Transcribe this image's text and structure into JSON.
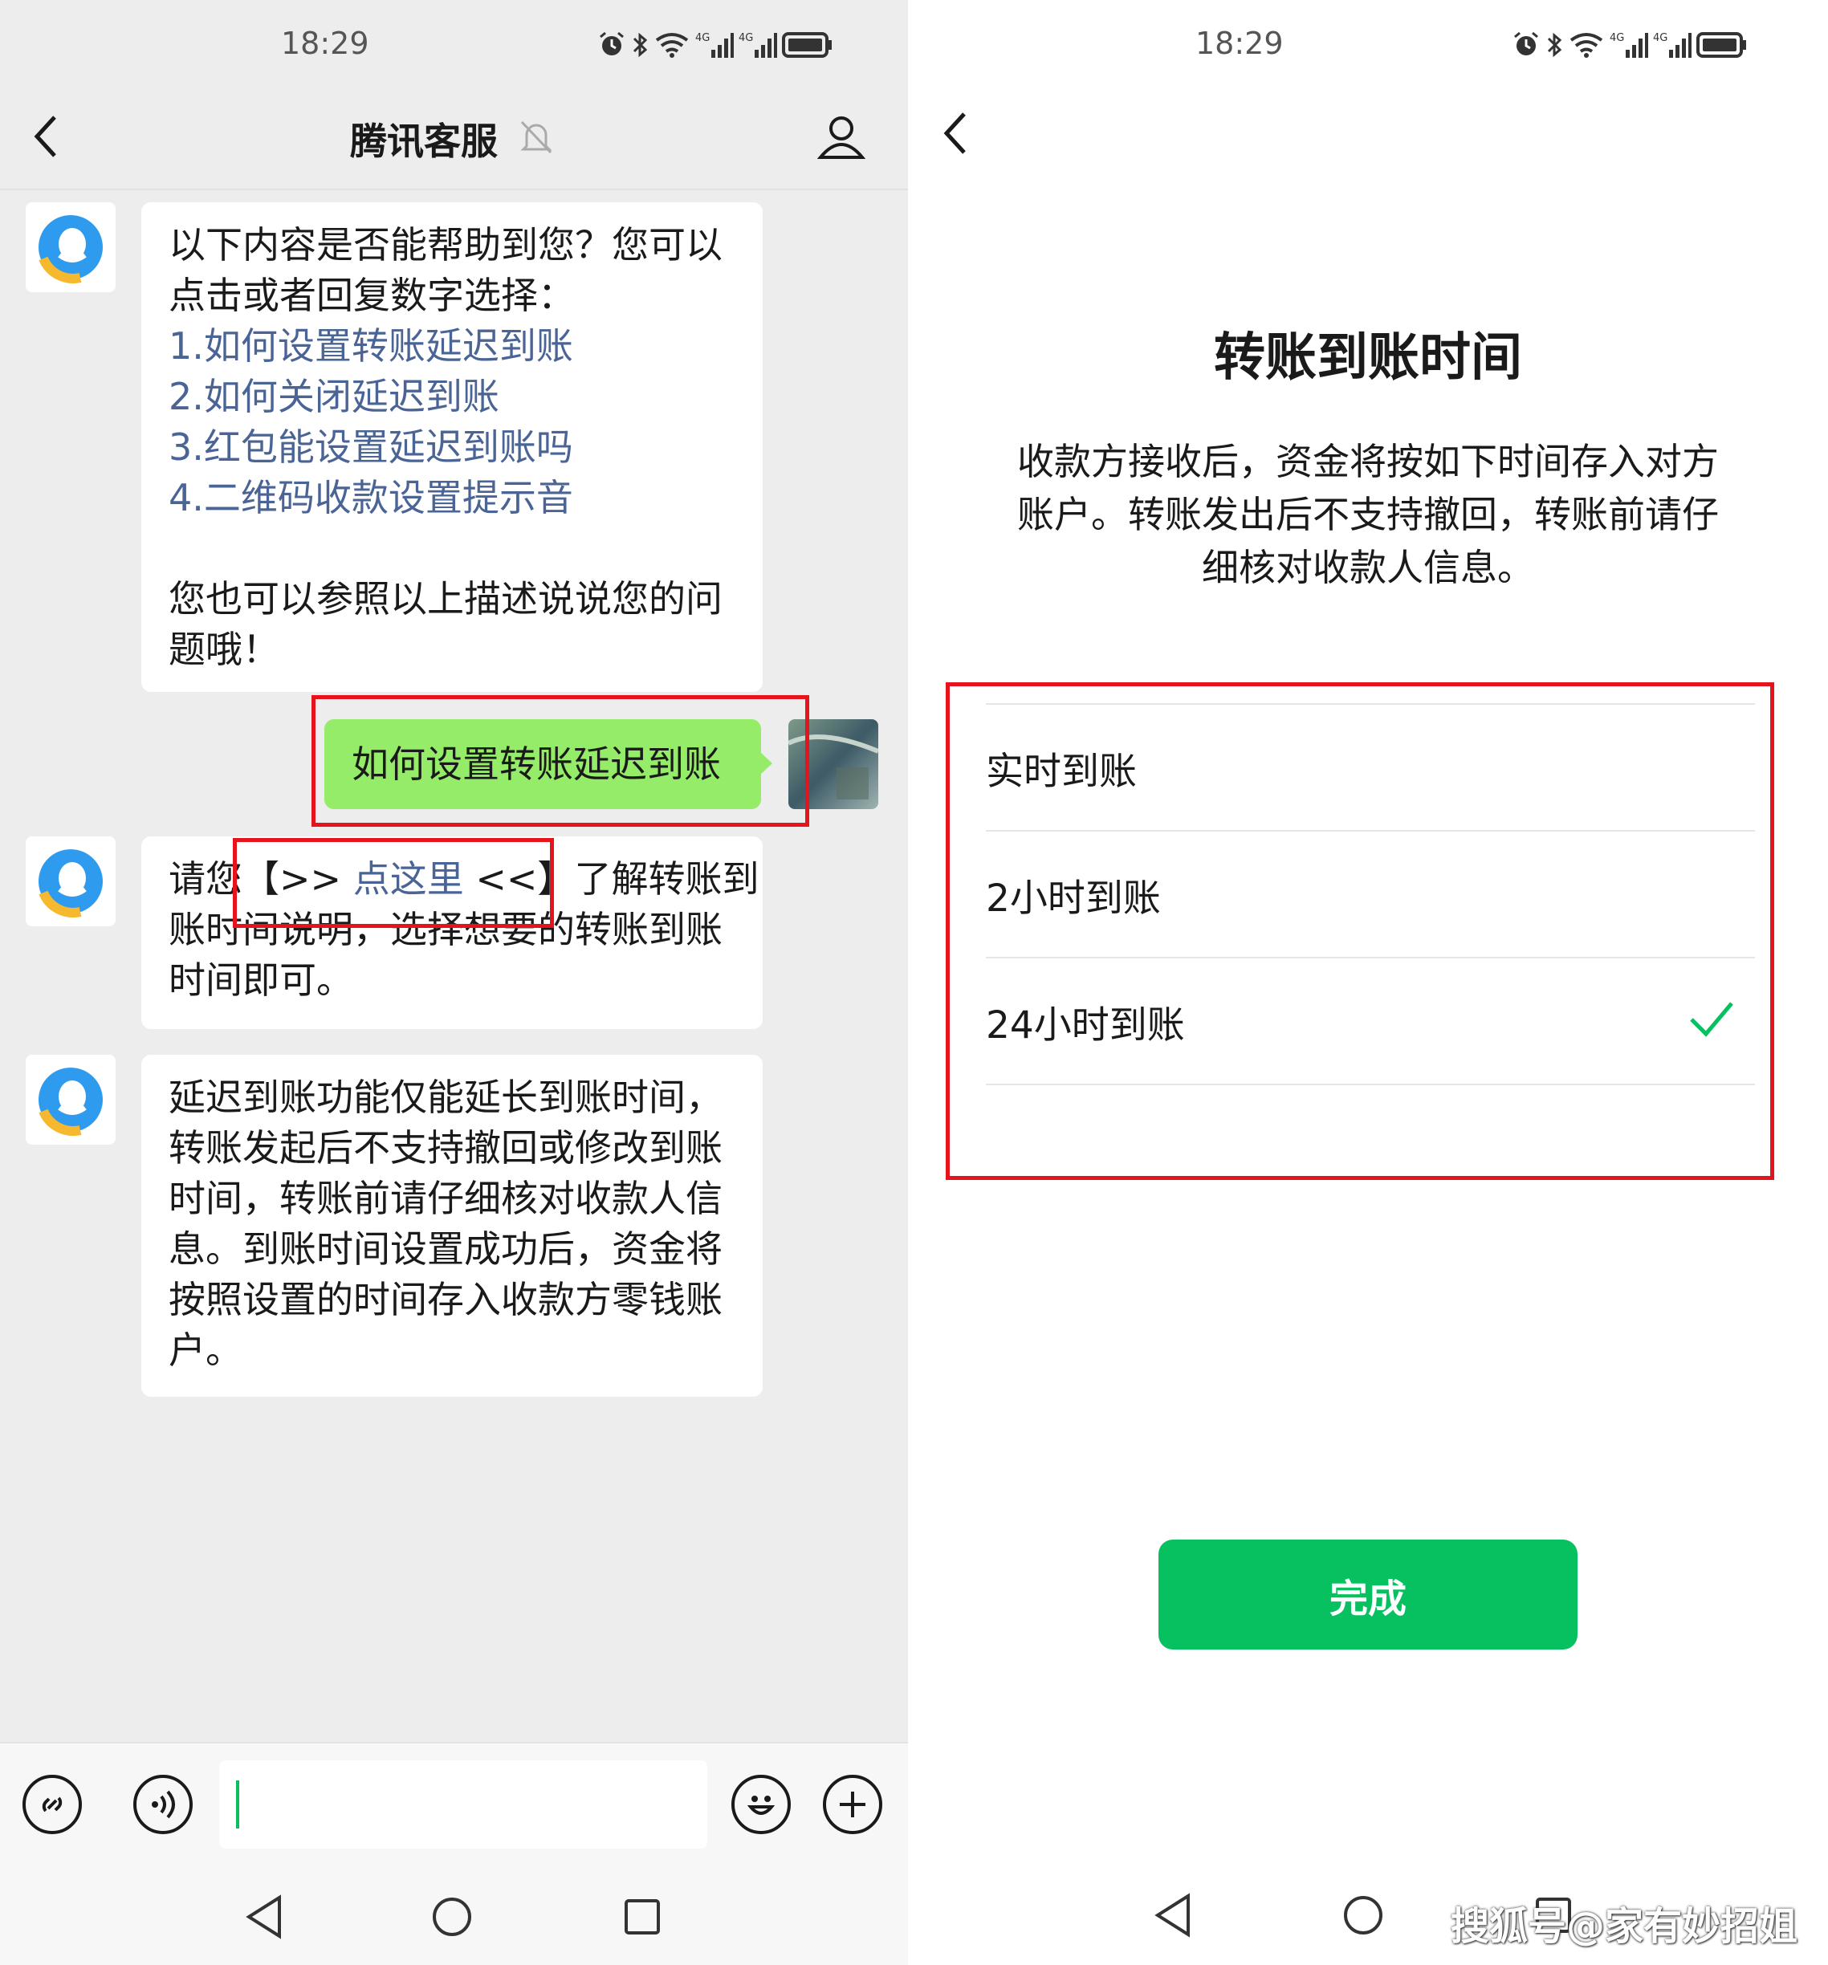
{
  "left": {
    "status": {
      "time": "18:29"
    },
    "header": {
      "title": "腾讯客服"
    },
    "messages": [
      {
        "lines": [
          "以下内容是否能帮助到您？您可以",
          "点击或者回复数字选择："
        ],
        "options": [
          "1.如何设置转账延迟到账",
          "2.如何关闭延迟到账",
          "3.红包能设置延迟到账吗",
          "4.二维码收款设置提示音"
        ],
        "tail_lines": [
          "您也可以参照以上描述说说您的问",
          "题哦！"
        ]
      },
      {
        "user_text": "如何设置转账延迟到账"
      },
      {
        "prefix": "请您",
        "bracket_open": "【>> ",
        "link": "点这里",
        "bracket_close": " <<】",
        "suffix": "了解转账到",
        "lines": [
          "账时间说明，选择想要的转账到账",
          "时间即可。"
        ]
      },
      {
        "lines": [
          "延迟到账功能仅能延长到账时间，",
          "转账发起后不支持撤回或修改到账",
          "时间，转账前请仔细核对收款人信",
          "息。到账时间设置成功后，资金将",
          "按照设置的时间存入收款方零钱账",
          "户。"
        ]
      }
    ]
  },
  "right": {
    "status": {
      "time": "18:29"
    },
    "title": "转账到账时间",
    "description": [
      "收款方接收后，资金将按如下时间存入对方",
      "账户。转账发出后不支持撤回，转账前请仔",
      "细核对收款人信息。"
    ],
    "options": [
      {
        "label": "实时到账",
        "selected": false
      },
      {
        "label": "2小时到账",
        "selected": false
      },
      {
        "label": "24小时到账",
        "selected": true
      }
    ],
    "done_label": "完成",
    "watermark": "搜狐号@家有妙招姐"
  },
  "colors": {
    "accent_green": "#07c160",
    "chat_green": "#95ec69",
    "link": "#4a6496",
    "highlight_red": "#e5141c"
  }
}
